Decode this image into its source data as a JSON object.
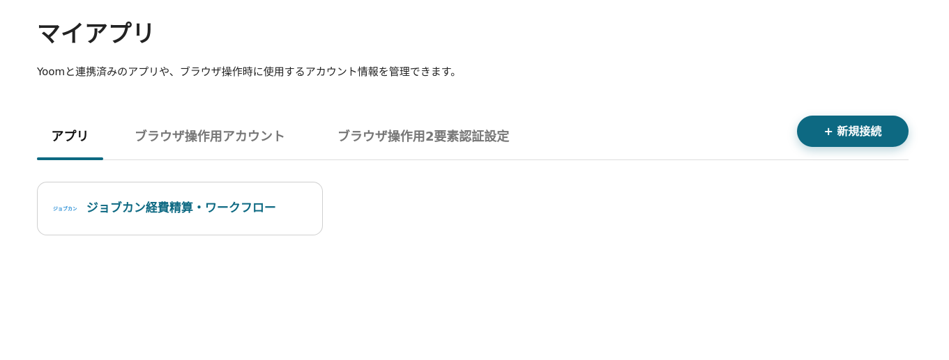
{
  "header": {
    "title": "マイアプリ",
    "description": "Yoomと連携済みのアプリや、ブラウザ操作時に使用するアカウント情報を管理できます。"
  },
  "tabs": [
    {
      "label": "アプリ",
      "active": true
    },
    {
      "label": "ブラウザ操作用アカウント",
      "active": false
    },
    {
      "label": "ブラウザ操作用2要素認証設定",
      "active": false
    }
  ],
  "actions": {
    "new_connection_label": "+ 新規接続"
  },
  "apps": [
    {
      "name": "ジョブカン経費精算・ワークフロー",
      "logo_text": "ジョブカン",
      "logo_icon": "jobcan-logo-icon"
    }
  ],
  "colors": {
    "accent": "#0d6982",
    "text_primary": "#222222",
    "tab_inactive": "#767676",
    "border": "#dedede",
    "logo_blue": "#2a8fd6"
  }
}
